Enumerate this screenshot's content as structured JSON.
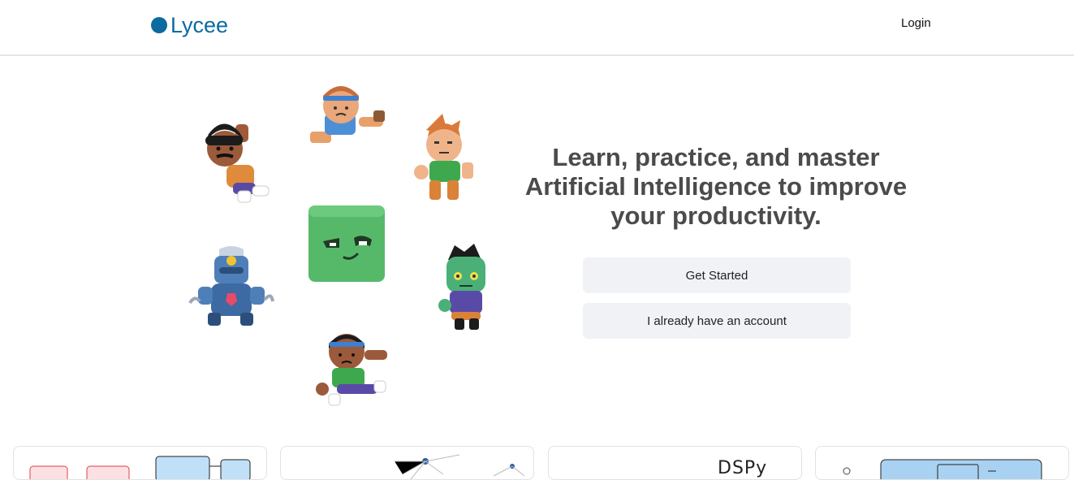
{
  "brand": {
    "name": "Lycee",
    "color": "#0b6aa2"
  },
  "header": {
    "login_label": "Login"
  },
  "hero": {
    "title": "Learn, practice, and master Artificial Intelligence to improve your productivity.",
    "primary_button": "Get Started",
    "secondary_button": "I already have an account"
  },
  "characters": [
    "girl-headband-character",
    "boy-curly-hair-character",
    "boy-ginger-character",
    "robot-character",
    "green-square-mascot",
    "zombie-character",
    "girl-green-shirt-character"
  ],
  "cards": [
    {
      "name": "diagram-card"
    },
    {
      "name": "graph-card"
    },
    {
      "name": "dspy-card",
      "logo_text": "DSPy"
    },
    {
      "name": "ui-mockup-card"
    }
  ]
}
